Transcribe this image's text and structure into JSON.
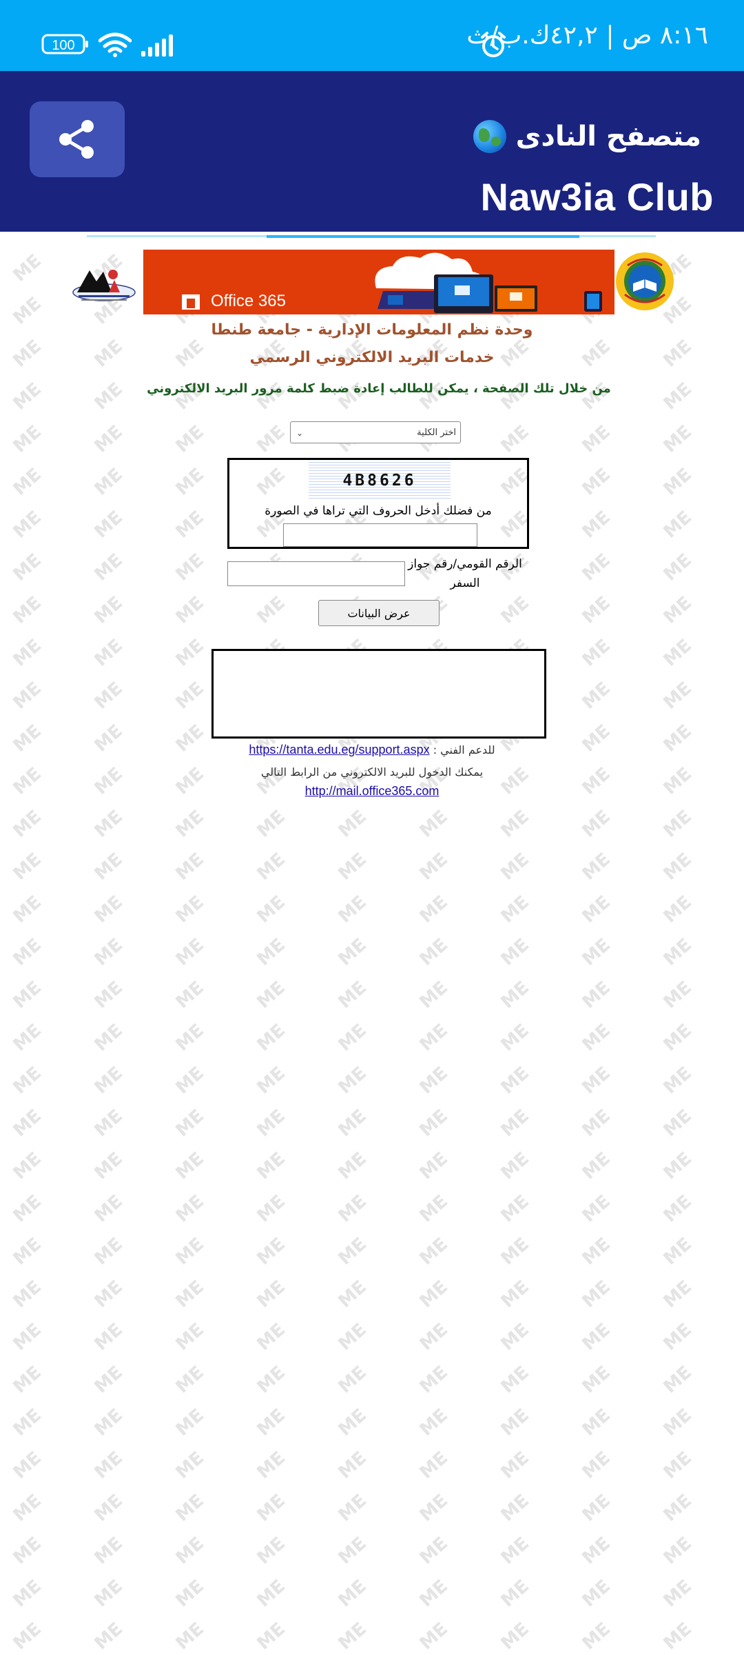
{
  "status_bar": {
    "time": "٨:١٦ ص | ٤٢,٢ك.ب/ث",
    "battery": "100"
  },
  "app_bar": {
    "title": "متصفح النادى",
    "subtitle": "Naw3ia Club"
  },
  "progress": {
    "value": 0.55
  },
  "banner": {
    "office_text": "Office 365"
  },
  "page": {
    "heading_1": "وحدة نظم المعلومات الإدارية - جامعة طنطا",
    "heading_2": "خدمات البريد الالكتروني الرسمي",
    "intro": "من خلال تلك الصفحة ، يمكن للطالب إعادة ضبط كلمة مرور البريد الالكتروني",
    "college_select": "اختر الكلية",
    "captcha_code": "4B8626",
    "captcha_label": "من فضلك أدخل الحروف التي تراها في الصورة",
    "captcha_value": "",
    "national_id_label": "الرقم القومي/رقم جواز السفر",
    "national_id_value": "",
    "submit_label": "عرض البيانات",
    "support_label": "للدعم الفني :",
    "support_link": "https://tanta.edu.eg/support.aspx",
    "office_access_label": "يمكنك الدخول للبريد الالكتروني من الرابط التالي",
    "office_link": "http://mail.office365.com"
  },
  "colors": {
    "status_bar": "#03a9f4",
    "app_bar": "#1a237e",
    "share_button": "#3f51b5",
    "office_banner": "#e03c0a",
    "heading": "#a0522d",
    "intro": "#1b5e20"
  }
}
